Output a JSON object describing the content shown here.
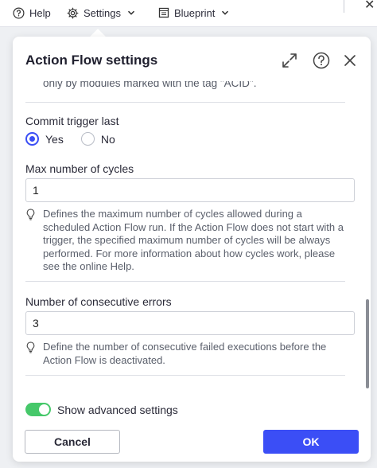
{
  "toolbar": {
    "help_label": "Help",
    "settings_label": "Settings",
    "blueprint_label": "Blueprint"
  },
  "dialog": {
    "title": "Action Flow settings",
    "cut_text": "only by modules marked with the tag \"ACID\".",
    "commit_trigger": {
      "label": "Commit trigger last",
      "options": [
        "Yes",
        "No"
      ],
      "selected": "Yes"
    },
    "max_cycles": {
      "label": "Max number of cycles",
      "value": "1",
      "hint": "Defines the maximum number of cycles allowed during a scheduled Action Flow run. If the Action Flow does not start with a trigger, the specified maximum number of cycles will be always performed. For more information about how cycles work, please see the online Help."
    },
    "consecutive_errors": {
      "label": "Number of consecutive errors",
      "value": "3",
      "hint": "Define the number of consecutive failed executions before the Action Flow is deactivated."
    },
    "advanced": {
      "label": "Show advanced settings",
      "enabled": true
    },
    "cancel_label": "Cancel",
    "ok_label": "OK"
  },
  "colors": {
    "accent": "#3b4ef6",
    "toggle_on": "#46c86a"
  }
}
